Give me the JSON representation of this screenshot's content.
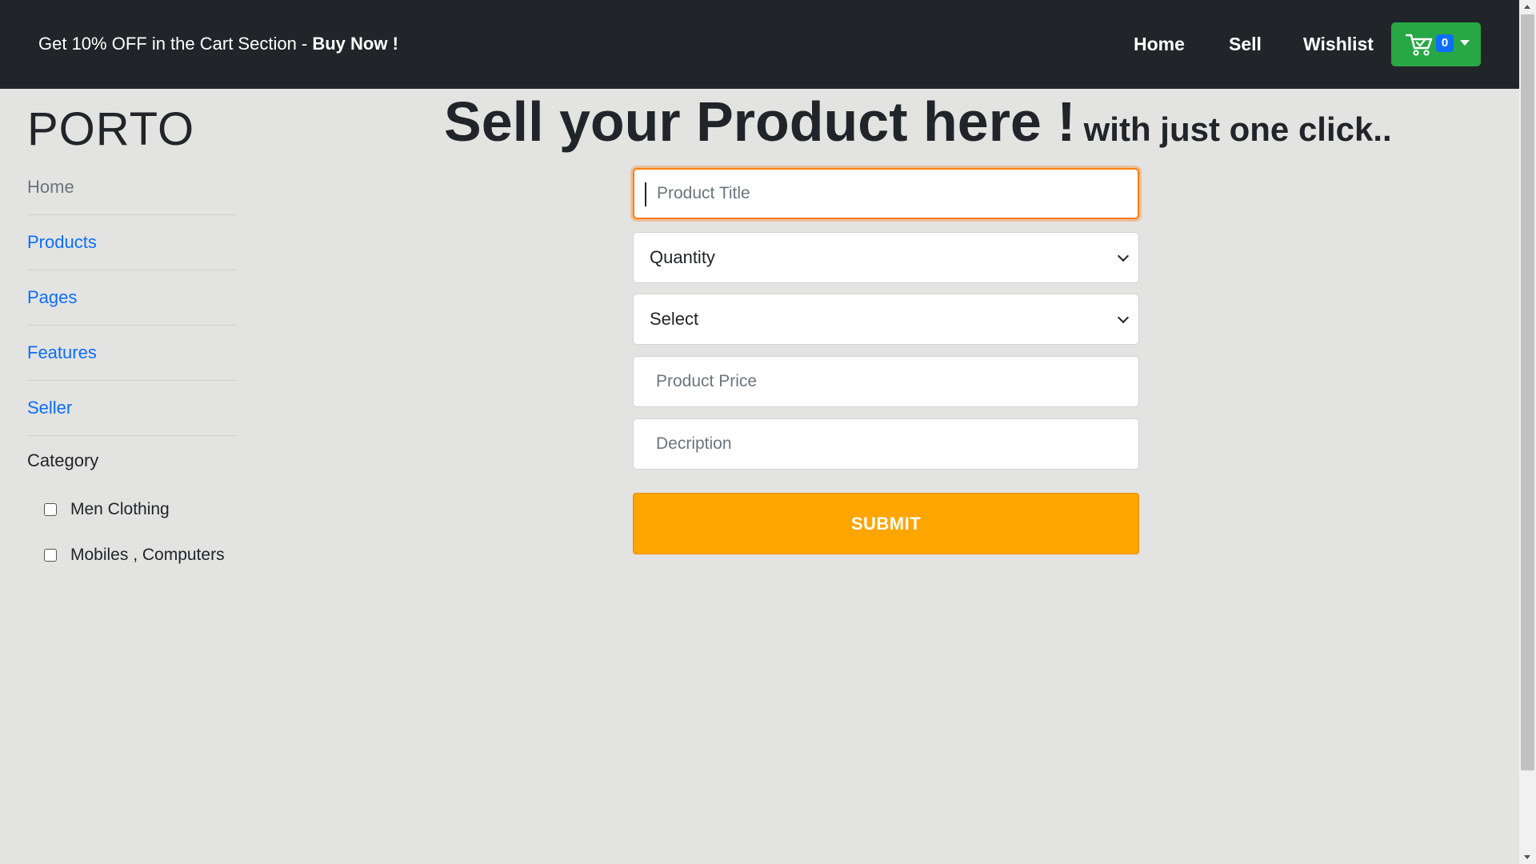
{
  "header": {
    "promo_text": "Get 10% OFF in the Cart Section - ",
    "promo_cta": "Buy Now !",
    "nav": [
      "Home",
      "Sell",
      "Wishlist"
    ],
    "cart": {
      "count": "0",
      "icon": "cart-icon",
      "color": "#28a745"
    },
    "background": "#212529"
  },
  "sidebar": {
    "brand": "PORTO",
    "items": [
      {
        "label": "Home"
      },
      {
        "label": "Products"
      },
      {
        "label": "Pages"
      },
      {
        "label": "Features"
      },
      {
        "label": "Seller"
      }
    ],
    "category_title": "Category",
    "categories": [
      {
        "label": "Men Clothing",
        "checked": false
      },
      {
        "label": "Mobiles , Computers",
        "checked": false
      }
    ]
  },
  "main": {
    "title": "Sell your Product here !",
    "subtitle": "with just one click..",
    "form": {
      "product_title_placeholder": "Product Title",
      "quantity_selected": "Quantity",
      "category_selected": "Select",
      "price_placeholder": "Product Price",
      "description_placeholder": "Decription",
      "submit_label": "SUBMIT",
      "submit_color": "#ffa500"
    }
  }
}
